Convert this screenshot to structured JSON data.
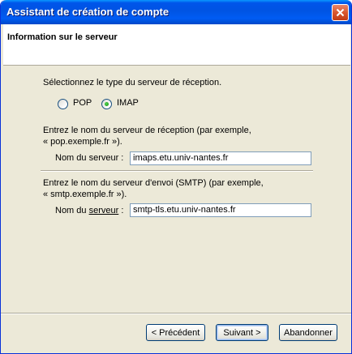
{
  "window": {
    "title": "Assistant de création de compte"
  },
  "header": {
    "title": "Information sur le serveur"
  },
  "incoming": {
    "prompt": "Sélectionnez le type du serveur de réception.",
    "options": [
      {
        "label": "POP",
        "selected": false
      },
      {
        "label": "IMAP",
        "selected": true
      }
    ],
    "description_line1": "Entrez le nom du serveur de réception (par exemple,",
    "description_line2": "« pop.exemple.fr »).",
    "field_label": "Nom du serveur :",
    "field_value": "imaps.etu.univ-nantes.fr"
  },
  "outgoing": {
    "description_line1": "Entrez le nom du serveur d'envoi (SMTP) (par exemple,",
    "description_line2": "« smtp.exemple.fr »).",
    "field_label_before": "Nom du ",
    "field_label_underlined": "serveur",
    "field_label_after": " :",
    "field_value": "smtp-tls.etu.univ-nantes.fr"
  },
  "buttons": {
    "back": "< Précédent",
    "next": "Suivant >",
    "cancel": "Abandonner"
  },
  "colors": {
    "titlebar": "#0054e3",
    "dialog_background": "#ece9d8",
    "radio_selected": "#21a121"
  }
}
